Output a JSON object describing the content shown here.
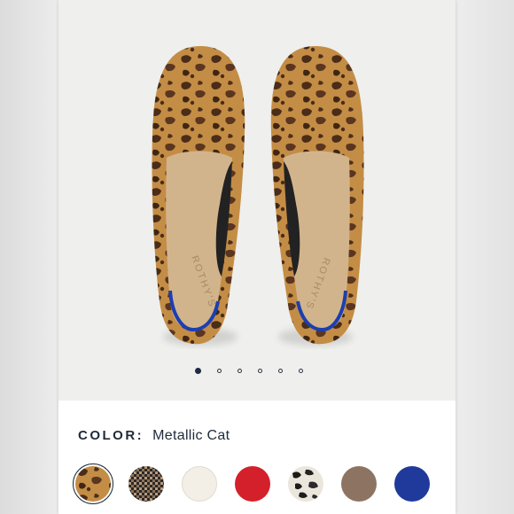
{
  "product": {
    "image_alt": "Leopard print knit loafers"
  },
  "carousel": {
    "total_slides": 6,
    "active_index": 0
  },
  "color_selector": {
    "label": "COLOR:",
    "selected_value": "Metallic Cat",
    "selected_index": 0,
    "swatches": [
      {
        "name": "leopard",
        "color": "#b5813c"
      },
      {
        "name": "black-camel-weave",
        "color": "#5b4a3c"
      },
      {
        "name": "cream",
        "color": "#f3efe6"
      },
      {
        "name": "red",
        "color": "#d3202a"
      },
      {
        "name": "snow-leopard",
        "color": "#e9e4da"
      },
      {
        "name": "taupe",
        "color": "#8d7462"
      },
      {
        "name": "navy-blue",
        "color": "#1f3a9a"
      }
    ]
  },
  "brand_mark": "ROTHY'S",
  "colors": {
    "text_dark": "#1f2a3a",
    "gallery_bg": "#efefed",
    "accent_blue": "#1c3fb0"
  }
}
